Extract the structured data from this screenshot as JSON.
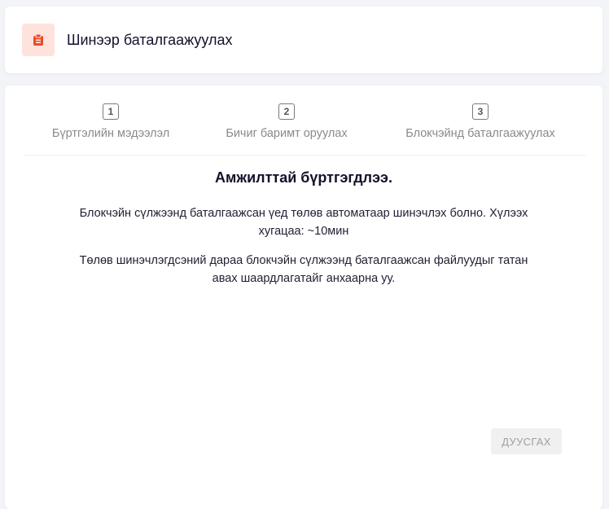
{
  "header": {
    "title": "Шинээр баталгаажуулах",
    "icon": "clipboard-icon",
    "icon_color": "#f04a24",
    "icon_bg": "#fde3dc"
  },
  "stepper": {
    "steps": [
      {
        "number": "1",
        "label": "Бүртгэлийн мэдээлэл"
      },
      {
        "number": "2",
        "label": "Бичиг баримт оруулах"
      },
      {
        "number": "3",
        "label": "Блокчэйнд баталгаажуулах"
      }
    ]
  },
  "result": {
    "title": "Амжилттай бүртгэгдлээ.",
    "paragraph1": "Блокчэйн сүлжээнд баталгаажсан үед төлөв автоматаар шинэчлэх болно. Хүлээх хугацаа: ~10мин",
    "paragraph2": "Төлөв шинэчлэгдсэний дараа блокчэйн сүлжээнд баталгаажсан файлуудыг татан авах шаардлагатайг анхаарна уу."
  },
  "actions": {
    "finish_label": "ДУУСГАХ"
  }
}
